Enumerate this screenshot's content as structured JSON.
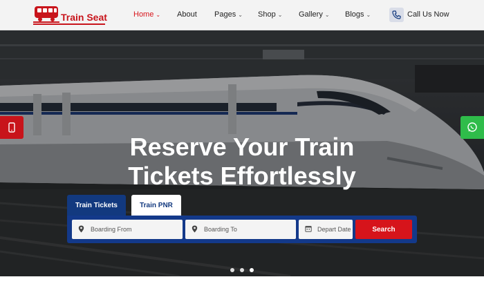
{
  "brand": {
    "name": "Train Seat",
    "color": "#c8141b"
  },
  "nav": {
    "items": [
      {
        "label": "Home",
        "has_dropdown": true,
        "active": true
      },
      {
        "label": "About",
        "has_dropdown": false,
        "active": false
      },
      {
        "label": "Pages",
        "has_dropdown": true,
        "active": false
      },
      {
        "label": "Shop",
        "has_dropdown": true,
        "active": false
      },
      {
        "label": "Gallery",
        "has_dropdown": true,
        "active": false
      },
      {
        "label": "Blogs",
        "has_dropdown": true,
        "active": false
      }
    ],
    "call_label": "Call Us Now",
    "call_icon": "phone-icon"
  },
  "hero": {
    "title_line1": "Reserve Your Train",
    "title_line2": "Tickets Effortlessly",
    "left_button_icon": "mobile-phone-icon",
    "right_button_icon": "whatsapp-icon"
  },
  "search": {
    "tabs": [
      {
        "label": "Train Tickets",
        "active": true
      },
      {
        "label": "Train PNR",
        "active": false
      }
    ],
    "from_placeholder": "Boarding From",
    "to_placeholder": "Boarding To",
    "date_placeholder": "Depart Date",
    "button_label": "Search"
  },
  "carousel": {
    "slides": 3,
    "active_index": 2
  },
  "colors": {
    "primary_blue": "#12397f",
    "accent_red": "#d6141b",
    "whatsapp_green": "#2fbc4a"
  }
}
